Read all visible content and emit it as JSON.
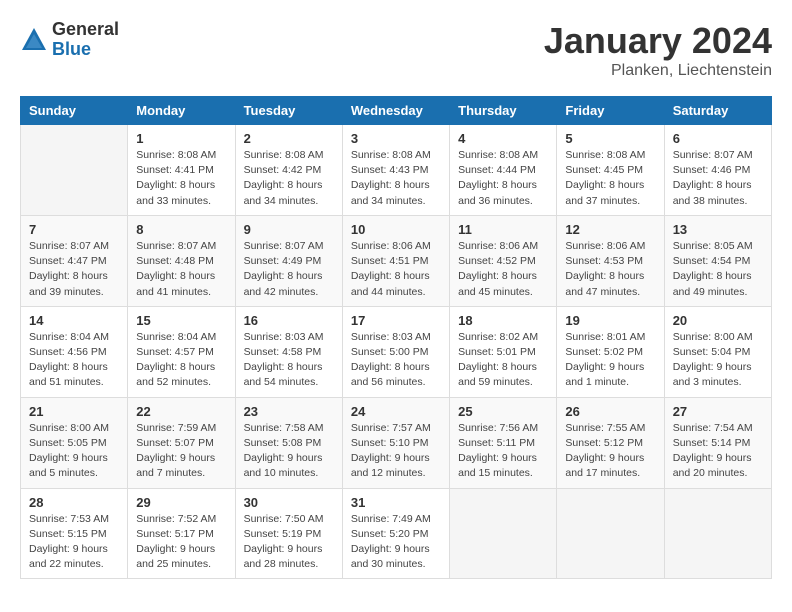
{
  "logo": {
    "general": "General",
    "blue": "Blue"
  },
  "header": {
    "title": "January 2024",
    "location": "Planken, Liechtenstein"
  },
  "days_of_week": [
    "Sunday",
    "Monday",
    "Tuesday",
    "Wednesday",
    "Thursday",
    "Friday",
    "Saturday"
  ],
  "weeks": [
    [
      {
        "day": "",
        "info": ""
      },
      {
        "day": "1",
        "info": "Sunrise: 8:08 AM\nSunset: 4:41 PM\nDaylight: 8 hours\nand 33 minutes."
      },
      {
        "day": "2",
        "info": "Sunrise: 8:08 AM\nSunset: 4:42 PM\nDaylight: 8 hours\nand 34 minutes."
      },
      {
        "day": "3",
        "info": "Sunrise: 8:08 AM\nSunset: 4:43 PM\nDaylight: 8 hours\nand 34 minutes."
      },
      {
        "day": "4",
        "info": "Sunrise: 8:08 AM\nSunset: 4:44 PM\nDaylight: 8 hours\nand 36 minutes."
      },
      {
        "day": "5",
        "info": "Sunrise: 8:08 AM\nSunset: 4:45 PM\nDaylight: 8 hours\nand 37 minutes."
      },
      {
        "day": "6",
        "info": "Sunrise: 8:07 AM\nSunset: 4:46 PM\nDaylight: 8 hours\nand 38 minutes."
      }
    ],
    [
      {
        "day": "7",
        "info": "Sunrise: 8:07 AM\nSunset: 4:47 PM\nDaylight: 8 hours\nand 39 minutes."
      },
      {
        "day": "8",
        "info": "Sunrise: 8:07 AM\nSunset: 4:48 PM\nDaylight: 8 hours\nand 41 minutes."
      },
      {
        "day": "9",
        "info": "Sunrise: 8:07 AM\nSunset: 4:49 PM\nDaylight: 8 hours\nand 42 minutes."
      },
      {
        "day": "10",
        "info": "Sunrise: 8:06 AM\nSunset: 4:51 PM\nDaylight: 8 hours\nand 44 minutes."
      },
      {
        "day": "11",
        "info": "Sunrise: 8:06 AM\nSunset: 4:52 PM\nDaylight: 8 hours\nand 45 minutes."
      },
      {
        "day": "12",
        "info": "Sunrise: 8:06 AM\nSunset: 4:53 PM\nDaylight: 8 hours\nand 47 minutes."
      },
      {
        "day": "13",
        "info": "Sunrise: 8:05 AM\nSunset: 4:54 PM\nDaylight: 8 hours\nand 49 minutes."
      }
    ],
    [
      {
        "day": "14",
        "info": "Sunrise: 8:04 AM\nSunset: 4:56 PM\nDaylight: 8 hours\nand 51 minutes."
      },
      {
        "day": "15",
        "info": "Sunrise: 8:04 AM\nSunset: 4:57 PM\nDaylight: 8 hours\nand 52 minutes."
      },
      {
        "day": "16",
        "info": "Sunrise: 8:03 AM\nSunset: 4:58 PM\nDaylight: 8 hours\nand 54 minutes."
      },
      {
        "day": "17",
        "info": "Sunrise: 8:03 AM\nSunset: 5:00 PM\nDaylight: 8 hours\nand 56 minutes."
      },
      {
        "day": "18",
        "info": "Sunrise: 8:02 AM\nSunset: 5:01 PM\nDaylight: 8 hours\nand 59 minutes."
      },
      {
        "day": "19",
        "info": "Sunrise: 8:01 AM\nSunset: 5:02 PM\nDaylight: 9 hours\nand 1 minute."
      },
      {
        "day": "20",
        "info": "Sunrise: 8:00 AM\nSunset: 5:04 PM\nDaylight: 9 hours\nand 3 minutes."
      }
    ],
    [
      {
        "day": "21",
        "info": "Sunrise: 8:00 AM\nSunset: 5:05 PM\nDaylight: 9 hours\nand 5 minutes."
      },
      {
        "day": "22",
        "info": "Sunrise: 7:59 AM\nSunset: 5:07 PM\nDaylight: 9 hours\nand 7 minutes."
      },
      {
        "day": "23",
        "info": "Sunrise: 7:58 AM\nSunset: 5:08 PM\nDaylight: 9 hours\nand 10 minutes."
      },
      {
        "day": "24",
        "info": "Sunrise: 7:57 AM\nSunset: 5:10 PM\nDaylight: 9 hours\nand 12 minutes."
      },
      {
        "day": "25",
        "info": "Sunrise: 7:56 AM\nSunset: 5:11 PM\nDaylight: 9 hours\nand 15 minutes."
      },
      {
        "day": "26",
        "info": "Sunrise: 7:55 AM\nSunset: 5:12 PM\nDaylight: 9 hours\nand 17 minutes."
      },
      {
        "day": "27",
        "info": "Sunrise: 7:54 AM\nSunset: 5:14 PM\nDaylight: 9 hours\nand 20 minutes."
      }
    ],
    [
      {
        "day": "28",
        "info": "Sunrise: 7:53 AM\nSunset: 5:15 PM\nDaylight: 9 hours\nand 22 minutes."
      },
      {
        "day": "29",
        "info": "Sunrise: 7:52 AM\nSunset: 5:17 PM\nDaylight: 9 hours\nand 25 minutes."
      },
      {
        "day": "30",
        "info": "Sunrise: 7:50 AM\nSunset: 5:19 PM\nDaylight: 9 hours\nand 28 minutes."
      },
      {
        "day": "31",
        "info": "Sunrise: 7:49 AM\nSunset: 5:20 PM\nDaylight: 9 hours\nand 30 minutes."
      },
      {
        "day": "",
        "info": ""
      },
      {
        "day": "",
        "info": ""
      },
      {
        "day": "",
        "info": ""
      }
    ]
  ]
}
